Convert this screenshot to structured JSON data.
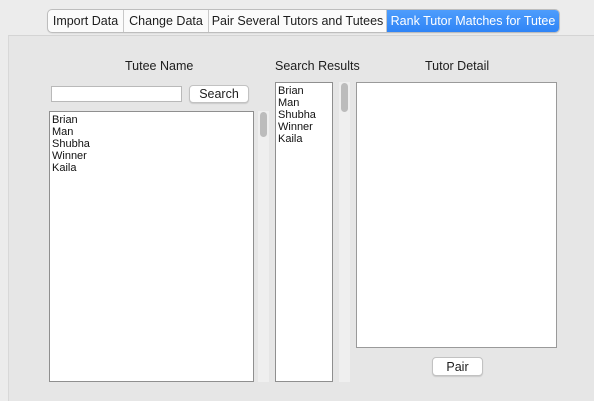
{
  "tabs": [
    {
      "label": "Import Data",
      "active": false
    },
    {
      "label": "Change Data",
      "active": false
    },
    {
      "label": "Pair Several Tutors and Tutees",
      "active": false
    },
    {
      "label": "Rank Tutor Matches for Tutee",
      "active": true
    }
  ],
  "tutee": {
    "heading": "Tutee Name",
    "search_value": "",
    "search_button": "Search",
    "names": [
      "Brian",
      "Man",
      "Shubha",
      "Winner",
      "Kaila"
    ]
  },
  "search_results": {
    "heading": "Search Results",
    "names": [
      "Brian",
      "Man",
      "Shubha",
      "Winner",
      "Kaila"
    ]
  },
  "tutor_detail": {
    "heading": "Tutor Detail",
    "content": "",
    "pair_button": "Pair"
  },
  "colors": {
    "active_tab": "#3a8ff8",
    "panel_background": "#e6e6e6"
  }
}
